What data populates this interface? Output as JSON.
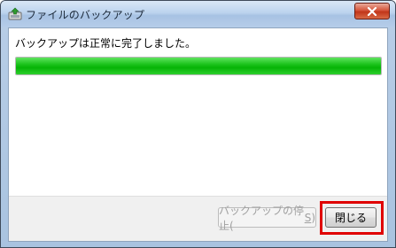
{
  "window": {
    "title": "ファイルのバックアップ",
    "icon": "backup-icon",
    "close_icon": "close-icon"
  },
  "main": {
    "message": "バックアップは正常に完了しました。",
    "progress_percent": 100,
    "progress_color": "#06b306"
  },
  "footer": {
    "stop_button_prefix": "バックアップの停止(",
    "stop_button_mnemonic": "S",
    "stop_button_suffix": ")",
    "close_button": "閉じる",
    "highlight_color": "#e00000"
  }
}
